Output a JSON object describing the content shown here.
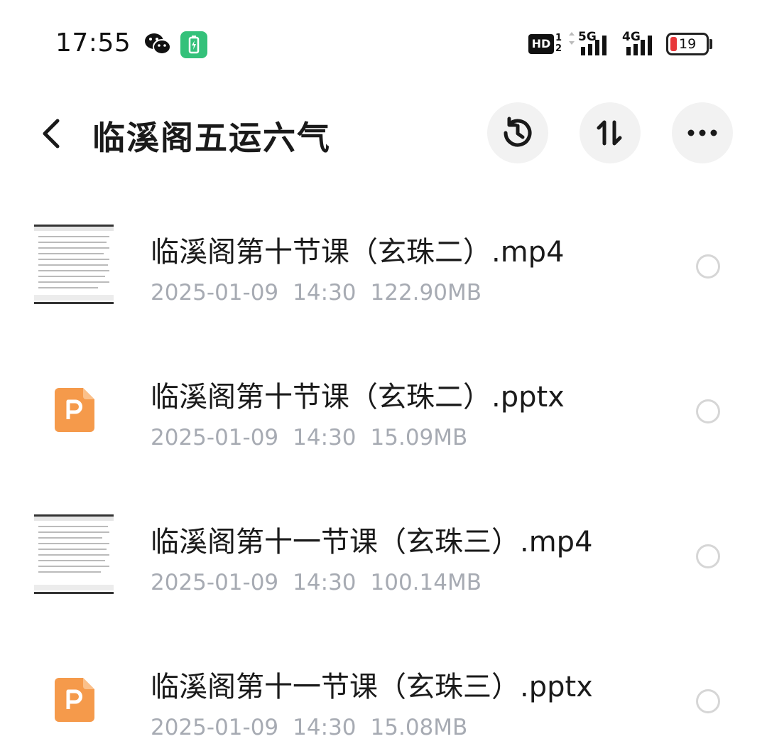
{
  "status_bar": {
    "time": "17:55",
    "hd_label": "HD",
    "network_1": "5G",
    "network_2": "4G",
    "battery_level": "19"
  },
  "header": {
    "title": "临溪阁五运六气",
    "back_icon": "chevron-left-icon",
    "history_icon": "history-icon",
    "sort_icon": "sort-icon",
    "more_icon": "more-horizontal-icon"
  },
  "files": [
    {
      "name": "临溪阁第十节课（玄珠二）.mp4",
      "date": "2025-01-09",
      "time": "14:30",
      "size": "122.90MB",
      "type": "video"
    },
    {
      "name": "临溪阁第十节课（玄珠二）.pptx",
      "date": "2025-01-09",
      "time": "14:30",
      "size": "15.09MB",
      "type": "pptx"
    },
    {
      "name": "临溪阁第十一节课（玄珠三）.mp4",
      "date": "2025-01-09",
      "time": "14:30",
      "size": "100.14MB",
      "type": "video"
    },
    {
      "name": "临溪阁第十一节课（玄珠三）.pptx",
      "date": "2025-01-09",
      "time": "14:30",
      "size": "15.08MB",
      "type": "pptx"
    }
  ],
  "colors": {
    "ppt_orange": "#f59a4b",
    "meta_gray": "#a7abb3",
    "charge_green": "#34c17a",
    "battery_red": "#e8383b"
  }
}
